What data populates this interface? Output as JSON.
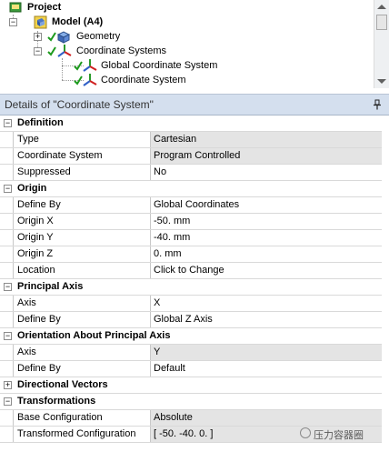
{
  "tree": {
    "items": [
      {
        "label": "Project",
        "icon": "project-icon"
      },
      {
        "label": "Model (A4)",
        "icon": "model-icon"
      },
      {
        "label": "Geometry",
        "icon": "geometry-icon"
      },
      {
        "label": "Coordinate Systems",
        "icon": "coordinate-systems-icon"
      },
      {
        "label": "Global Coordinate System",
        "icon": "coordinate-system-icon"
      },
      {
        "label": "Coordinate System",
        "icon": "coordinate-system-icon"
      }
    ]
  },
  "details": {
    "title": "Details of \"Coordinate System\"",
    "pin_icon": "pin-icon"
  },
  "sections": {
    "definition": {
      "label": "Definition",
      "rows": [
        {
          "name": "Type",
          "value": "Cartesian"
        },
        {
          "name": "Coordinate System",
          "value": "Program Controlled"
        },
        {
          "name": "Suppressed",
          "value": "No"
        }
      ]
    },
    "origin": {
      "label": "Origin",
      "rows": [
        {
          "name": "Define By",
          "value": "Global Coordinates"
        },
        {
          "name": "Origin X",
          "value": "-50. mm"
        },
        {
          "name": "Origin Y",
          "value": "-40. mm"
        },
        {
          "name": "Origin Z",
          "value": "0. mm"
        },
        {
          "name": "Location",
          "value": "Click to Change"
        }
      ]
    },
    "principal_axis": {
      "label": "Principal Axis",
      "rows": [
        {
          "name": "Axis",
          "value": "X"
        },
        {
          "name": "Define By",
          "value": "Global Z Axis"
        }
      ]
    },
    "orientation": {
      "label": "Orientation About Principal Axis",
      "rows": [
        {
          "name": "Axis",
          "value": "Y"
        },
        {
          "name": "Define By",
          "value": "Default"
        }
      ]
    },
    "directional_vectors": {
      "label": "Directional Vectors"
    },
    "transformations": {
      "label": "Transformations",
      "rows": [
        {
          "name": "Base Configuration",
          "value": "Absolute"
        },
        {
          "name": "Transformed Configuration",
          "value": "[ -50. -40. 0. ]"
        }
      ]
    }
  },
  "watermark": {
    "text": "压力容器圈"
  }
}
